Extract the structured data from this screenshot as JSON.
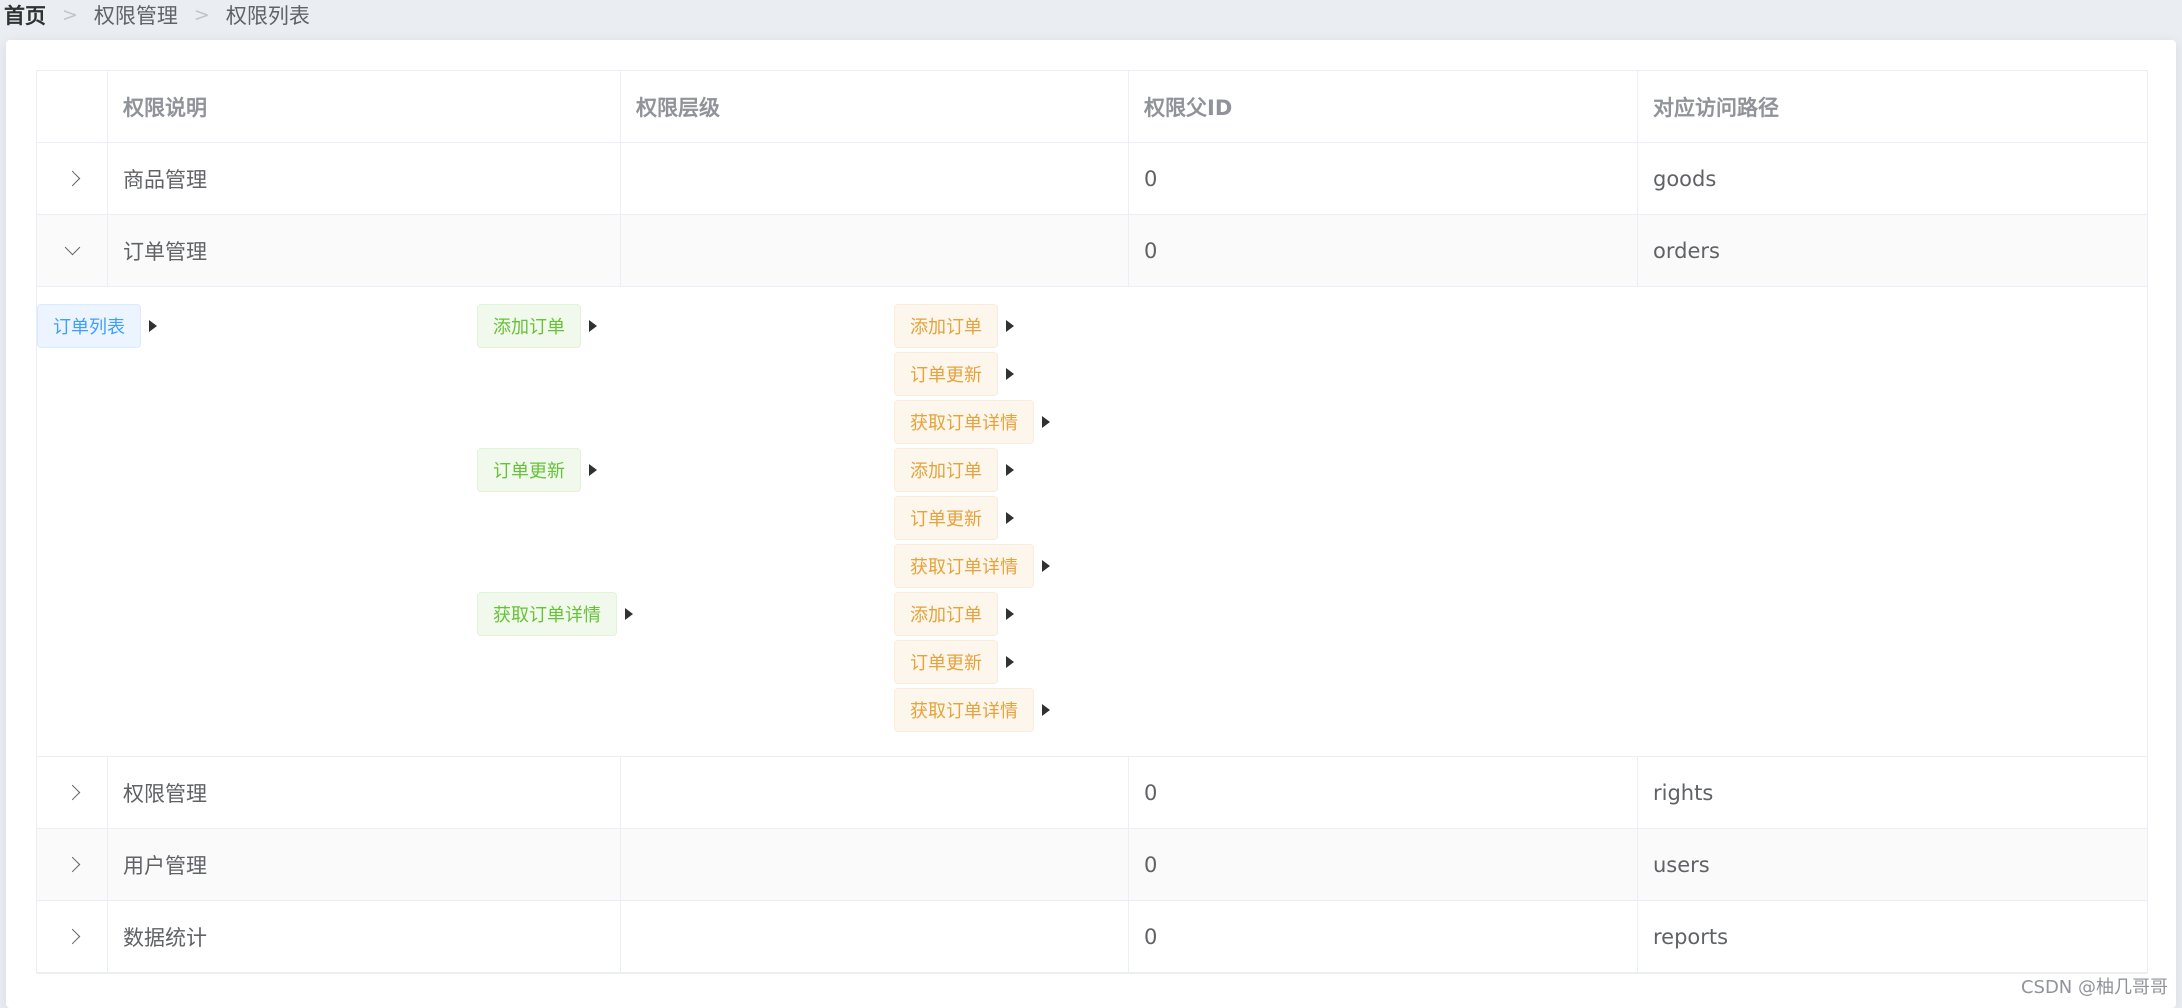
{
  "breadcrumb": [
    "首页",
    "权限管理",
    "权限列表"
  ],
  "table": {
    "headers": [
      "权限说明",
      "权限层级",
      "权限父ID",
      "对应访问路径"
    ],
    "rows": [
      {
        "name": "商品管理",
        "level": "",
        "pid": "0",
        "path": "goods",
        "expanded": false
      },
      {
        "name": "订单管理",
        "level": "",
        "pid": "0",
        "path": "orders",
        "expanded": true
      },
      {
        "name": "权限管理",
        "level": "",
        "pid": "0",
        "path": "rights",
        "expanded": false
      },
      {
        "name": "用户管理",
        "level": "",
        "pid": "0",
        "path": "users",
        "expanded": false
      },
      {
        "name": "数据统计",
        "level": "",
        "pid": "0",
        "path": "reports",
        "expanded": false
      }
    ]
  },
  "expanded_tree": {
    "level1": [
      "订单列表"
    ],
    "level2": [
      "添加订单",
      "订单更新",
      "获取订单详情"
    ],
    "level3": [
      "添加订单",
      "订单更新",
      "获取订单详情",
      "添加订单",
      "订单更新",
      "获取订单详情",
      "添加订单",
      "订单更新",
      "获取订单详情"
    ]
  },
  "watermark": "CSDN @柚几哥哥",
  "colors": {
    "level1_tag": "#409eff",
    "level2_tag": "#67c23a",
    "level3_tag": "#e6a23c"
  }
}
